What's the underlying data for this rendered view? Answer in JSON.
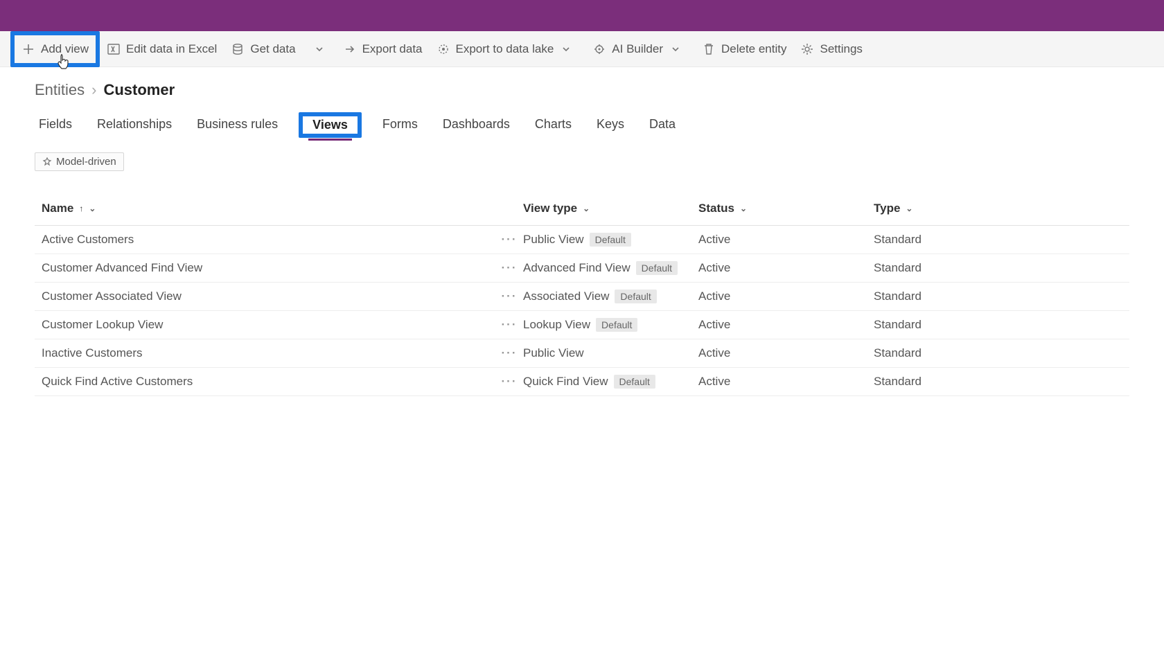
{
  "cmdbar": {
    "add_view": "Add view",
    "edit_excel": "Edit data in Excel",
    "get_data": "Get data",
    "export_data": "Export data",
    "export_lake": "Export to data lake",
    "ai_builder": "AI Builder",
    "delete_entity": "Delete entity",
    "settings": "Settings"
  },
  "breadcrumb": {
    "root": "Entities",
    "current": "Customer"
  },
  "tabs": {
    "fields": "Fields",
    "relationships": "Relationships",
    "business_rules": "Business rules",
    "views": "Views",
    "forms": "Forms",
    "dashboards": "Dashboards",
    "charts": "Charts",
    "keys": "Keys",
    "data": "Data"
  },
  "filter_chip": "Model-driven",
  "columns": {
    "name": "Name",
    "view_type": "View type",
    "status": "Status",
    "type": "Type"
  },
  "badge_default": "Default",
  "more_glyph": "···",
  "rows": [
    {
      "name": "Active Customers",
      "view_type": "Public View",
      "default": true,
      "status": "Active",
      "type": "Standard"
    },
    {
      "name": "Customer Advanced Find View",
      "view_type": "Advanced Find View",
      "default": true,
      "status": "Active",
      "type": "Standard"
    },
    {
      "name": "Customer Associated View",
      "view_type": "Associated View",
      "default": true,
      "status": "Active",
      "type": "Standard"
    },
    {
      "name": "Customer Lookup View",
      "view_type": "Lookup View",
      "default": true,
      "status": "Active",
      "type": "Standard"
    },
    {
      "name": "Inactive Customers",
      "view_type": "Public View",
      "default": false,
      "status": "Active",
      "type": "Standard"
    },
    {
      "name": "Quick Find Active Customers",
      "view_type": "Quick Find View",
      "default": true,
      "status": "Active",
      "type": "Standard"
    }
  ]
}
